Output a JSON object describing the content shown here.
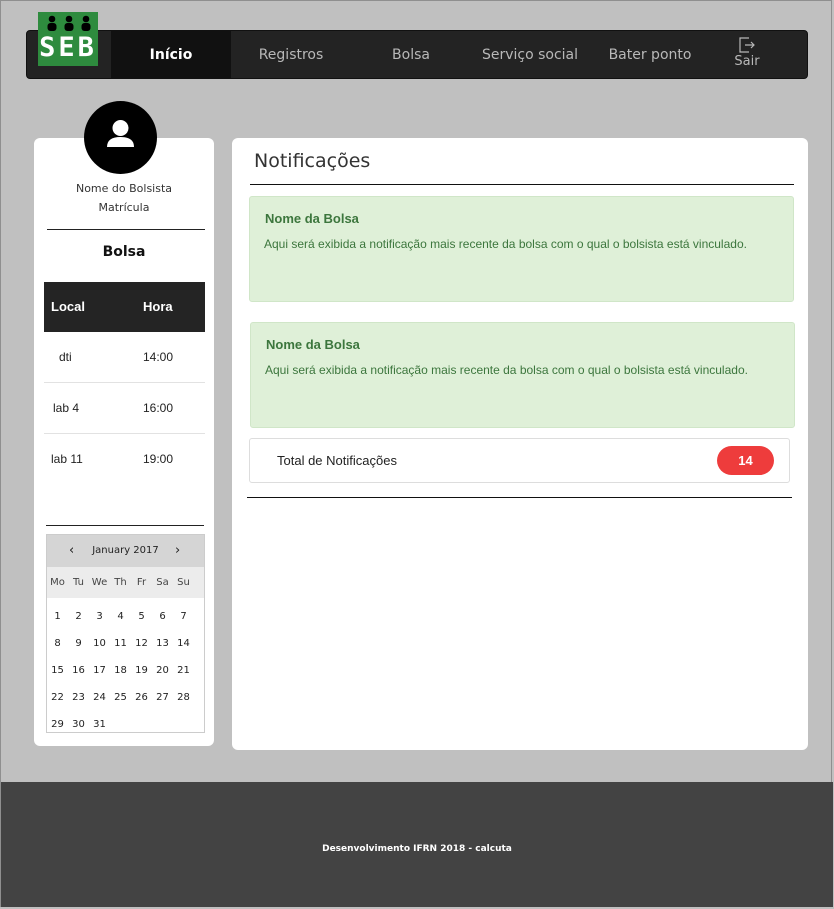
{
  "brand": {
    "logo_text": "SEB",
    "color": "#2e8b3e"
  },
  "nav": {
    "items": [
      {
        "label": "Início",
        "active": true
      },
      {
        "label": "Registros",
        "active": false
      },
      {
        "label": "Bolsa",
        "active": false
      },
      {
        "label": "Serviço social",
        "active": false
      },
      {
        "label": "Bater ponto",
        "active": false
      }
    ],
    "logout": {
      "label": "Sair",
      "icon": "logout-icon"
    }
  },
  "profile": {
    "avatar_icon": "user-icon",
    "name": "Nome do Bolsista",
    "registration": "Matrícula",
    "section_title": "Bolsa"
  },
  "schedule": {
    "headers": [
      "Local",
      "Hora"
    ],
    "rows": [
      {
        "local": "dti",
        "hora": "14:00"
      },
      {
        "local": "lab 4",
        "hora": "16:00"
      },
      {
        "local": "lab 11",
        "hora": "19:00"
      }
    ]
  },
  "calendar": {
    "month": "January 2017",
    "weekdays": [
      "Mo",
      "Tu",
      "We",
      "Th",
      "Fr",
      "Sa",
      "Su"
    ],
    "days": [
      1,
      2,
      3,
      4,
      5,
      6,
      7,
      8,
      9,
      10,
      11,
      12,
      13,
      14,
      15,
      16,
      17,
      18,
      19,
      20,
      21,
      22,
      23,
      24,
      25,
      26,
      27,
      28,
      29,
      30,
      31
    ]
  },
  "notifications": {
    "title": "Notificações",
    "items": [
      {
        "title": "Nome da Bolsa",
        "body": "Aqui será exibida a notificação mais recente da bolsa com o qual o bolsista está vinculado."
      },
      {
        "title": "Nome da Bolsa",
        "body": "Aqui será exibida a notificação mais recente da bolsa com o qual o bolsista está vinculado."
      }
    ],
    "total_label": "Total de Notificações",
    "total_count": "14",
    "badge_color": "#ee3c3c",
    "notification_bg": "#dff0d8",
    "notification_text_color": "#3c763d"
  },
  "footer": {
    "text": "Desenvolvimento IFRN 2018 - calcuta"
  }
}
